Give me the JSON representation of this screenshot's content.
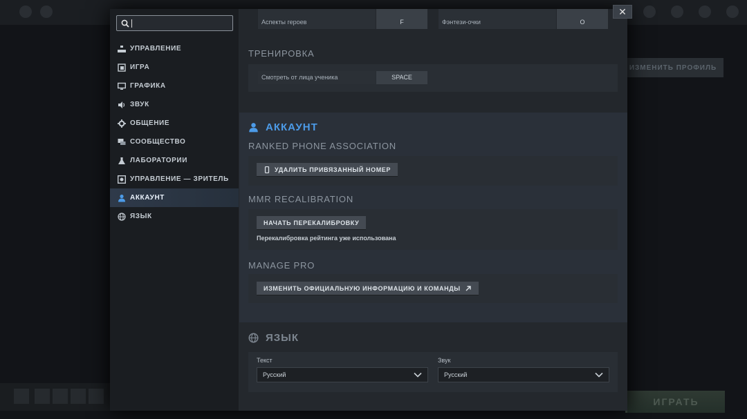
{
  "sidebar": {
    "search": {
      "value": "",
      "placeholder": ""
    },
    "items": [
      {
        "label": "УПРАВЛЕНИЕ",
        "icon": "controls-icon"
      },
      {
        "label": "ИГРА",
        "icon": "game-icon"
      },
      {
        "label": "ГРАФИКА",
        "icon": "monitor-icon"
      },
      {
        "label": "ЗВУК",
        "icon": "speaker-icon"
      },
      {
        "label": "ОБЩЕНИЕ",
        "icon": "gear-icon"
      },
      {
        "label": "СООБЩЕСТВО",
        "icon": "chat-icon"
      },
      {
        "label": "ЛАБОРАТОРИИ",
        "icon": "flask-icon"
      },
      {
        "label": "УПРАВЛЕНИЕ — ЗРИТЕЛЬ",
        "icon": "spectator-icon"
      },
      {
        "label": "АККАУНТ",
        "icon": "user-icon",
        "active": true
      },
      {
        "label": "ЯЗЫК",
        "icon": "globe-icon"
      }
    ]
  },
  "hotkeys": {
    "row1": {
      "left_label": "Аспекты героев",
      "left_key": "F",
      "right_label": "Фэнтези-очки",
      "right_key": "O"
    },
    "training_title": "ТРЕНИРОВКА",
    "training_row": {
      "label": "Смотреть от лица ученика",
      "key": "SPACE"
    }
  },
  "account": {
    "title": "АККАУНТ",
    "phone_section": "RANKED PHONE ASSOCIATION",
    "phone_button": "УДАЛИТЬ ПРИВЯЗАННЫЙ НОМЕР",
    "mmr_section": "MMR RECALIBRATION",
    "mmr_button": "НАЧАТЬ ПЕРЕКАЛИБРОВКУ",
    "mmr_note": "Перекалибровка рейтинга уже использована",
    "pro_section": "MANAGE PRO",
    "pro_button": "ИЗМЕНИТЬ ОФИЦИАЛЬНУЮ ИНФОРМАЦИЮ И КОМАНДЫ"
  },
  "language": {
    "title": "ЯЗЫК",
    "text_label": "Текст",
    "text_value": "Русский",
    "sound_label": "Звук",
    "sound_value": "Русский"
  },
  "background": {
    "profile_button": "ИЗМЕНИТЬ ПРОФИЛЬ",
    "play_button": "ИГРАТЬ"
  },
  "colors": {
    "accent": "#4c9be8",
    "active_nav": "#2f3a4a"
  }
}
